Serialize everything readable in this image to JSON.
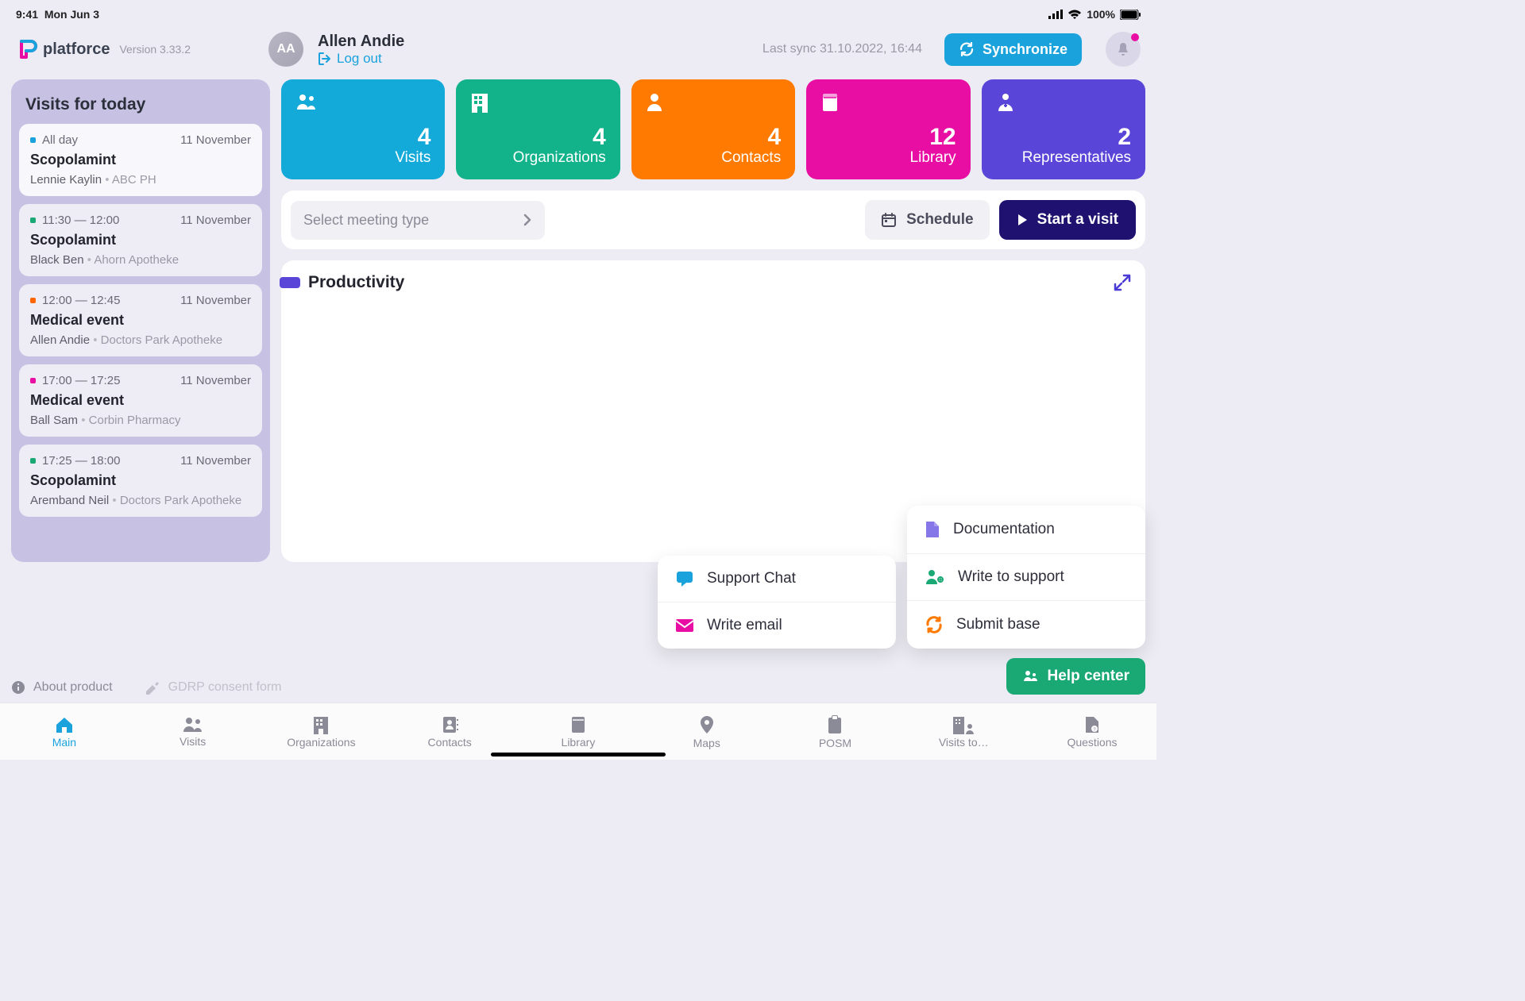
{
  "status": {
    "time": "9:41",
    "date": "Mon Jun 3",
    "battery": "100%"
  },
  "app": {
    "name": "platforce",
    "version": "Version 3.33.2"
  },
  "user": {
    "initials": "AA",
    "name": "Allen Andie",
    "logout": "Log out"
  },
  "sync": {
    "last": "Last sync 31.10.2022, 16:44",
    "btn": "Synchronize"
  },
  "sidebar": {
    "title": "Visits for today",
    "items": [
      {
        "color": "#1aa2dd",
        "time": "All day",
        "date": "11 November",
        "title": "Scopolamint",
        "person": "Lennie Kaylin",
        "org": "ABC PH",
        "active": true
      },
      {
        "color": "#1aa874",
        "time": "11:30 — 12:00",
        "date": "11 November",
        "title": "Scopolamint",
        "person": "Black Ben",
        "org": "Ahorn Apotheke"
      },
      {
        "color": "#ff6600",
        "time": "12:00 — 12:45",
        "date": "11 November",
        "title": "Medical event",
        "person": "Allen Andie",
        "org": "Doctors Park Apotheke"
      },
      {
        "color": "#e90ea3",
        "time": "17:00 — 17:25",
        "date": "11 November",
        "title": "Medical event",
        "person": "Ball Sam",
        "org": "Corbin Pharmacy"
      },
      {
        "color": "#1aa874",
        "time": "17:25 — 18:00",
        "date": "11 November",
        "title": "Scopolamint",
        "person": "Aremband Neil",
        "org": "Doctors Park Apotheke"
      }
    ]
  },
  "tiles": [
    {
      "color": "#13a9d9",
      "count": "4",
      "label": "Visits",
      "icon": "users"
    },
    {
      "color": "#12b38a",
      "count": "4",
      "label": "Organizations",
      "icon": "building"
    },
    {
      "color": "#ff7a00",
      "count": "4",
      "label": "Contacts",
      "icon": "user"
    },
    {
      "color": "#e90ea3",
      "count": "12",
      "label": "Library",
      "icon": "book"
    },
    {
      "color": "#5946d8",
      "count": "2",
      "label": "Representatives",
      "icon": "doctor"
    }
  ],
  "actions": {
    "select_placeholder": "Select meeting type",
    "schedule": "Schedule",
    "start": "Start a visit"
  },
  "productivity": {
    "title": "Productivity"
  },
  "popover1": [
    {
      "icon": "chat",
      "color": "#1aa2dd",
      "label": "Support Chat"
    },
    {
      "icon": "mail",
      "color": "#e90ea3",
      "label": "Write email"
    }
  ],
  "popover2": [
    {
      "icon": "doc",
      "color": "#8677e8",
      "label": "Documentation"
    },
    {
      "icon": "support",
      "color": "#1aa874",
      "label": "Write to support"
    },
    {
      "icon": "refresh",
      "color": "#ff7a00",
      "label": "Submit base"
    }
  ],
  "help": "Help center",
  "footer": {
    "about": "About product",
    "gdrp": "GDRP consent form"
  },
  "nav": [
    {
      "label": "Main",
      "icon": "home",
      "active": true
    },
    {
      "label": "Visits",
      "icon": "users"
    },
    {
      "label": "Organizations",
      "icon": "building"
    },
    {
      "label": "Contacts",
      "icon": "contact"
    },
    {
      "label": "Library",
      "icon": "book"
    },
    {
      "label": "Maps",
      "icon": "pin"
    },
    {
      "label": "POSM",
      "icon": "clipboard"
    },
    {
      "label": "Visits to…",
      "icon": "visit-org"
    },
    {
      "label": "Questions",
      "icon": "question"
    }
  ]
}
